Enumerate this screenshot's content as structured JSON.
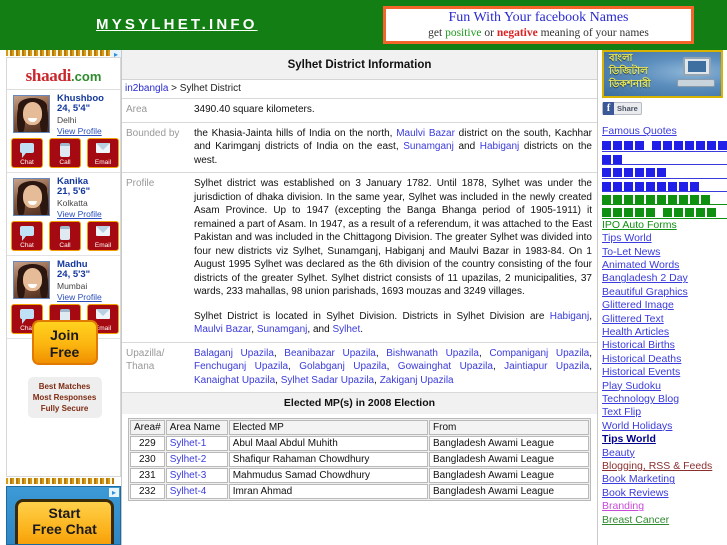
{
  "header": {
    "site_logo": "MYSYLHET.INFO",
    "banner_ad": {
      "line1": "Fun With Your facebook Names",
      "line2_pre": "get ",
      "line2_positive": "positive",
      "line2_mid": " or ",
      "line2_negative": "negative",
      "line2_post": " meaning of your names"
    }
  },
  "left_ad": {
    "adchoices_icon": "adchoices-icon",
    "brand_shaadi": "shaadi",
    "brand_dotcom": ".com",
    "profiles": [
      {
        "name": "Khushboo",
        "age_height": "24, 5'4\"",
        "city": "Delhi",
        "view_profile": "View Profile",
        "actions": [
          {
            "label": "Chat",
            "icon": "chat-icon"
          },
          {
            "label": "Call",
            "icon": "phone-icon"
          },
          {
            "label": "Email",
            "icon": "envelope-icon"
          }
        ]
      },
      {
        "name": "Kanika",
        "age_height": "21, 5'6\"",
        "city": "Kolkatta",
        "view_profile": "View Profile",
        "actions": [
          {
            "label": "Chat",
            "icon": "chat-icon"
          },
          {
            "label": "Call",
            "icon": "phone-icon"
          },
          {
            "label": "Email",
            "icon": "envelope-icon"
          }
        ]
      },
      {
        "name": "Madhu",
        "age_height": "24, 5'3\"",
        "city": "Mumbai",
        "view_profile": "View Profile",
        "actions": [
          {
            "label": "Chat",
            "icon": "chat-icon"
          },
          {
            "label": "Call",
            "icon": "phone-icon"
          },
          {
            "label": "Email",
            "icon": "envelope-icon"
          }
        ]
      }
    ],
    "join_free_line1": "Join",
    "join_free_line2": "Free",
    "benefits": [
      "Best Matches",
      "Most Responses",
      "Fully Secure"
    ],
    "bottom_ad": {
      "line1": "Start",
      "line2": "Free Chat",
      "adchoices_icon": "adchoices-icon"
    }
  },
  "main": {
    "page_title": "Sylhet District Information",
    "breadcrumb": {
      "link": "in2bangla",
      "separator": " > ",
      "current": "Sylhet District"
    },
    "rows": [
      {
        "label": "Area",
        "value": "3490.40 square kilometers."
      },
      {
        "label": "Bounded by",
        "value": "the Khasia-Jainta hills of India on the north, Maulvi Bazar district on the south, Kachhar and Karimganj districts of India on the east, Sunamganj and Habiganj districts on the west.",
        "links": [
          "Maulvi Bazar",
          "Sunamganj",
          "Habiganj"
        ]
      },
      {
        "label": "Profile",
        "paragraph1": "Sylhet district was established on 3 January 1782. Until 1878, Sylhet was under the jurisdiction of dhaka division. In the same year, Sylhet was included in the newly created Asam Province. Up to 1947 (excepting the Banga Bhanga period of 1905-1911) it remained a part of Asam. In 1947, as a result of a referendum, it was attached to the East Pakistan and was included in the Chittagong Division. The greater Sylhet was divided into four new districts viz Sylhet, Sunamganj, Habiganj and Maulvi Bazar in 1983-84. On 1 August 1995 Sylhet was declared as the 6th division of the country consisting of the four districts of the greater Sylhet. Sylhet district consists of 11 upazilas, 2 municipalities, 37 wards, 233 mahallas, 98 union parishads, 1693 mouzas and 3249 villages.",
        "paragraph2_pre": "Sylhet District is located in Sylhet Division. Districts in Sylhet Division are ",
        "paragraph2_links": [
          "Habiganj",
          "Maulvi Bazar",
          "Sunamganj",
          "Sylhet"
        ]
      },
      {
        "label_line1": "Upazilla/",
        "label_line2": "Thana",
        "upazilas": [
          "Balaganj Upazila",
          "Beanibazar Upazila",
          "Bishwanath Upazila",
          "Companiganj Upazila",
          "Fenchuganj Upazila",
          "Golabganj Upazila",
          "Gowainghat Upazila",
          "Jaintiapur Upazila",
          "Kanaighat Upazila",
          "Sylhet Sadar Upazila",
          "Zakiganj Upazila"
        ]
      }
    ],
    "mp_section_title": "Elected MP(s) in 2008 Election",
    "mp_table": {
      "headers": [
        "Area#",
        "Area Name",
        "Elected MP",
        "From"
      ],
      "rows": [
        [
          "229",
          "Sylhet-1",
          "Abul Maal Abdul Muhith",
          "Bangladesh Awami League"
        ],
        [
          "230",
          "Sylhet-2",
          "Shafiqur Rahaman Chowdhury",
          "Bangladesh Awami League"
        ],
        [
          "231",
          "Sylhet-3",
          "Mahmudus Samad Chowdhury",
          "Bangladesh Awami League"
        ],
        [
          "232",
          "Sylhet-4",
          "Imran Ahmad",
          "Bangladesh Awami League"
        ]
      ]
    }
  },
  "right_sidebar": {
    "dictionary_ad": {
      "line1": "বাংলা",
      "line2": "ডিজিটাল",
      "line3": "ডিকশনারী",
      "icon": "computer-icon"
    },
    "fb_share": {
      "icon": "facebook-f-icon",
      "label": "Share"
    },
    "famous_quotes": "Famous Quotes",
    "tofu_rows": [
      {
        "color": "blue",
        "pattern": [
          4,
          8
        ]
      },
      {
        "color": "blue",
        "pattern": [
          2
        ]
      },
      {
        "color": "blue",
        "pattern": [
          6
        ]
      },
      {
        "color": "blue",
        "pattern": [
          9
        ]
      },
      {
        "color": "green",
        "pattern": [
          10
        ]
      },
      {
        "color": "green",
        "pattern": [
          5,
          5
        ]
      }
    ],
    "links": [
      {
        "label": "IPO Auto Forms",
        "color": "#109010",
        "bold": false
      },
      {
        "label": "Tips World",
        "color": "#3b3bdd",
        "bold": false
      },
      {
        "label": "To-Let News",
        "color": "#3b3bdd",
        "bold": false
      },
      {
        "label": "Animated Words",
        "color": "#3b3bdd",
        "bold": false
      },
      {
        "label": "Bangladesh 2 Day",
        "color": "#3b3bdd",
        "bold": false
      },
      {
        "label": "Beautiful Graphics",
        "color": "#3b3bdd",
        "bold": false
      },
      {
        "label": "Glittered Image",
        "color": "#3b3bdd",
        "bold": false
      },
      {
        "label": "Glittered Text",
        "color": "#3b3bdd",
        "bold": false
      },
      {
        "label": "Health Articles",
        "color": "#3b3bdd",
        "bold": false
      },
      {
        "label": "Historical Births",
        "color": "#3b3bdd",
        "bold": false
      },
      {
        "label": "Historical Deaths",
        "color": "#3b3bdd",
        "bold": false
      },
      {
        "label": "Historical Events",
        "color": "#3b3bdd",
        "bold": false
      },
      {
        "label": "Play Sudoku",
        "color": "#3b3bdd",
        "bold": false
      },
      {
        "label": "Technology Blog",
        "color": "#3b3bdd",
        "bold": false
      },
      {
        "label": "Text Flip",
        "color": "#3b3bdd",
        "bold": false
      },
      {
        "label": "World Holidays",
        "color": "#3b3bdd",
        "bold": false
      },
      {
        "label": "Tips World",
        "color": "#00008b",
        "bold": true
      },
      {
        "label": "Beauty",
        "color": "#3b3bdd",
        "bold": false
      },
      {
        "label": "Blogging, RSS & Feeds",
        "color": "#8b2f2f",
        "bold": false
      },
      {
        "label": "Book Marketing",
        "color": "#3b3bdd",
        "bold": false
      },
      {
        "label": "Book Reviews",
        "color": "#3b3bdd",
        "bold": false
      },
      {
        "label": "Branding",
        "color": "#c84ad8",
        "bold": false
      },
      {
        "label": "Breast Cancer",
        "color": "#2f8a2f",
        "bold": false
      }
    ]
  }
}
